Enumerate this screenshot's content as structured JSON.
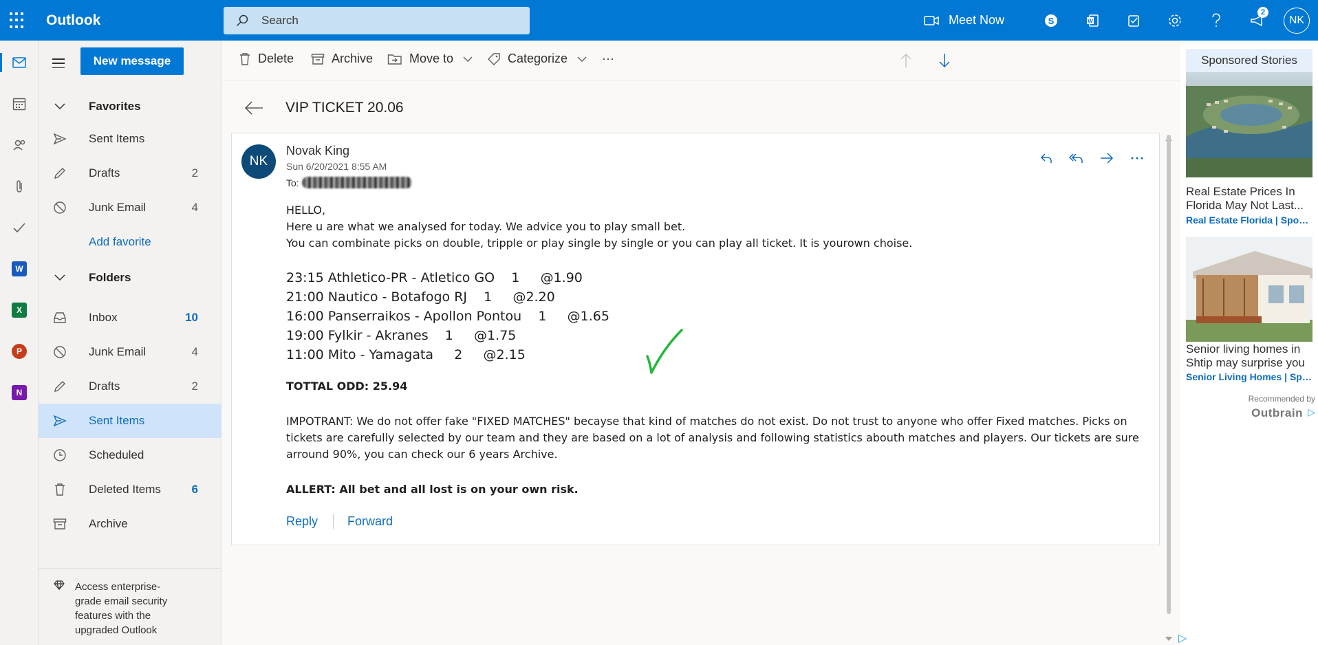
{
  "app": {
    "title": "Outlook"
  },
  "search": {
    "placeholder": "Search"
  },
  "topbar": {
    "meet_now": "Meet Now",
    "notification_count": "2",
    "user_initials": "NK"
  },
  "folders": {
    "new_message": "New message",
    "favorites": {
      "header": "Favorites",
      "items": [
        {
          "label": "Sent Items",
          "count": ""
        },
        {
          "label": "Drafts",
          "count": "2"
        },
        {
          "label": "Junk Email",
          "count": "4"
        }
      ],
      "add_favorite": "Add favorite"
    },
    "folders_header": "Folders",
    "items": [
      {
        "label": "Inbox",
        "count": "10"
      },
      {
        "label": "Junk Email",
        "count": "4"
      },
      {
        "label": "Drafts",
        "count": "2"
      },
      {
        "label": "Sent Items",
        "count": ""
      },
      {
        "label": "Scheduled",
        "count": ""
      },
      {
        "label": "Deleted Items",
        "count": "6"
      },
      {
        "label": "Archive",
        "count": ""
      }
    ],
    "promo": "Access enterprise-grade email security features with the upgraded Outlook"
  },
  "toolbar": {
    "delete": "Delete",
    "archive": "Archive",
    "move_to": "Move to",
    "categorize": "Categorize",
    "more": "···"
  },
  "message": {
    "subject": "VIP TICKET 20.06",
    "sender_initials": "NK",
    "sender": "Novak King",
    "date": "Sun 6/20/2021 8:55 AM",
    "to_label": "To:",
    "greeting": "HELLO,",
    "line1": "Here u are what we analysed for today. We advice you to play small bet.",
    "line2": "You can combinate picks on double, tripple or play single by single or you can play all ticket. It is yourown choise.",
    "picks": [
      "23:15 Athletico-PR - Atletico GO    1     @1.90",
      "21:00 Nautico - Botafogo RJ    1     @2.20",
      "16:00 Panserraikos - Apollon Pontou    1     @1.65",
      "19:00 Fylkir - Akranes    1     @1.75",
      "11:00 Mito - Yamagata     2     @2.15"
    ],
    "total": "TOTTAL ODD: 25.94",
    "important": "IMPOTRANT: We do not offer fake \"FIXED MATCHES\" becayse that kind of matches do not exist. Do not trust to anyone who offer Fixed matches. Picks on tickets are carefully selected by our team and they are based on a lot of analysis and following statistics abouth matches and players. Our tickets are sure arround 90%, you can check our 6 years Archive.",
    "allert": "ALLERT: All bet and all lost is on your own risk.",
    "reply": "Reply",
    "forward": "Forward"
  },
  "ads": {
    "header": "Sponsored Stories",
    "items": [
      {
        "title": "Real Estate Prices In\nFlorida May Not Last...",
        "source": "Real Estate Florida | Spons..."
      },
      {
        "title": "Senior living homes in\nShtip may surprise you",
        "source": "Senior Living Homes | Spo..."
      }
    ],
    "recommended_by": "Recommended by",
    "outbrain": "Outbrain"
  },
  "colors": {
    "accent": "#0078d4",
    "selected": "#cfe4fa",
    "checkmark": "#22b83a"
  }
}
